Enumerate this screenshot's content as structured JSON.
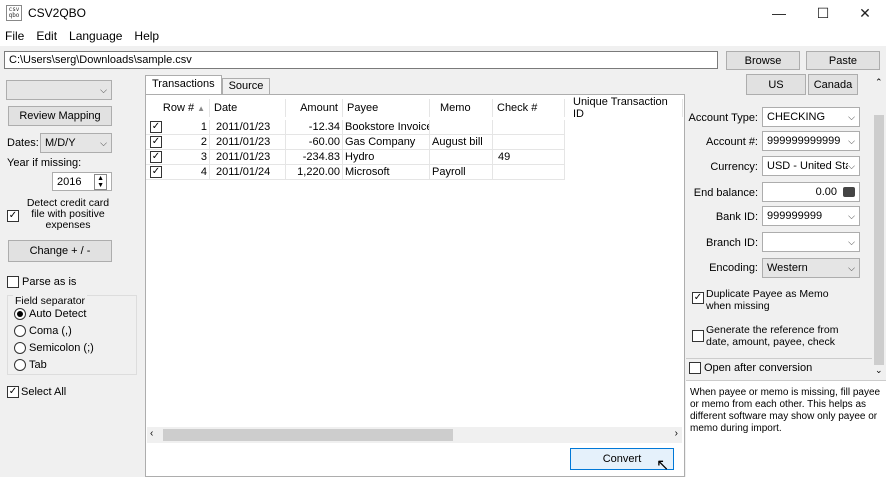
{
  "window": {
    "title": "CSV2QBO",
    "icon_text": "csv qbo",
    "minimize": "—",
    "maximize": "☐",
    "close": "✕"
  },
  "menu": [
    "File",
    "Edit",
    "Language",
    "Help"
  ],
  "path": {
    "value": "C:\\Users\\serg\\Downloads\\sample.csv",
    "browse": "Browse",
    "paste": "Paste"
  },
  "left": {
    "top_combo": "",
    "review_mapping": "Review Mapping",
    "dates_label": "Dates:",
    "dates_value": "M/D/Y",
    "year_label": "Year if missing:",
    "year_value": "2016",
    "detect_label": "Detect credit card file with positive expenses",
    "change_button": "Change + / -",
    "parse_as_is": "Parse as is",
    "field_separator": "Field separator",
    "separators": [
      "Auto Detect",
      "Coma (,)",
      "Semicolon (;)",
      "Tab"
    ],
    "select_all": "Select All"
  },
  "tabs": [
    "Transactions",
    "Source"
  ],
  "table": {
    "headers": [
      "Row #",
      "Date",
      "Amount",
      "Payee",
      "Memo",
      "Check #",
      "Unique Transaction ID"
    ],
    "rows": [
      {
        "row": "1",
        "date": "2011/01/23",
        "amount": "-12.34",
        "payee": "Bookstore Invoice",
        "memo": "",
        "check": ""
      },
      {
        "row": "2",
        "date": "2011/01/23",
        "amount": "-60.00",
        "payee": "Gas Company",
        "memo": "August bill",
        "check": ""
      },
      {
        "row": "3",
        "date": "2011/01/23",
        "amount": "-234.83",
        "payee": "Hydro",
        "memo": "",
        "check": "49"
      },
      {
        "row": "4",
        "date": "2011/01/24",
        "amount": "1,220.00",
        "payee": "Microsoft",
        "memo": "Payroll",
        "check": ""
      }
    ]
  },
  "convert": "Convert",
  "right": {
    "us": "US",
    "canada": "Canada",
    "account_type_label": "Account Type:",
    "account_type_value": "CHECKING",
    "account_num_label": "Account #:",
    "account_num_value": "999999999999",
    "currency_label": "Currency:",
    "currency_value": "USD - United Sta",
    "end_balance_label": "End balance:",
    "end_balance_value": "0.00",
    "bank_id_label": "Bank ID:",
    "bank_id_value": "999999999",
    "branch_id_label": "Branch ID:",
    "branch_id_value": "",
    "encoding_label": "Encoding:",
    "encoding_value": "Western",
    "dup_payee": "Duplicate Payee as Memo when missing",
    "gen_ref": "Generate the reference from date, amount, payee, check",
    "open_after": "Open after conversion",
    "help_text": "When payee or memo is missing, fill payee or memo from each other. This helps as different software may show only payee or memo during import."
  }
}
